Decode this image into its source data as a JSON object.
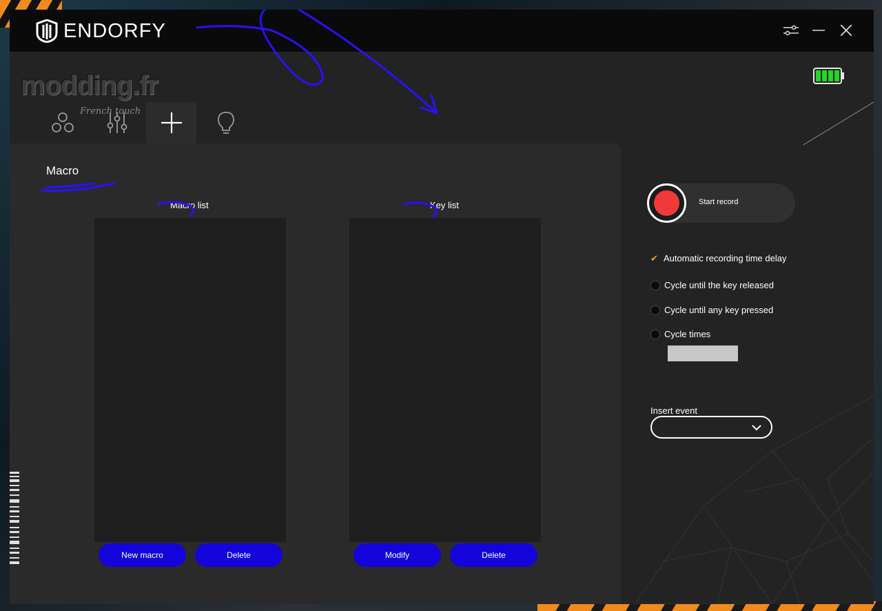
{
  "app": {
    "brand": "ENDORFY"
  },
  "watermark": {
    "main": "modding.fr",
    "sub": "French touch"
  },
  "titlebar": {
    "controls": [
      "settings-sliders-icon",
      "minimize-icon",
      "close-icon"
    ]
  },
  "battery": {
    "level": 1.0,
    "color": "#22d822"
  },
  "tabs": [
    {
      "icon": "circles-icon",
      "active": false
    },
    {
      "icon": "equalizer-icon",
      "active": false
    },
    {
      "icon": "plus-icon",
      "active": true
    },
    {
      "icon": "lightbulb-icon",
      "active": false
    }
  ],
  "panel": {
    "title": "Macro"
  },
  "macro_list": {
    "label": "Macro list",
    "items": [],
    "new_label": "New macro",
    "delete_label": "Delete"
  },
  "key_list": {
    "label": "Key list",
    "items": [],
    "modify_label": "Modify",
    "delete_label": "Delete"
  },
  "record": {
    "label": "Start record"
  },
  "options": {
    "auto_delay": {
      "label": "Automatic recording time delay",
      "checked": true
    },
    "cycle_release": {
      "label": "Cycle until the key released",
      "selected": false
    },
    "cycle_any": {
      "label": "Cycle until any key pressed",
      "selected": false
    },
    "cycle_times": {
      "label": "Cycle times",
      "selected": false,
      "value": ""
    }
  },
  "insert_event": {
    "label": "Insert event",
    "value": ""
  },
  "colors": {
    "accent": "#1404d9",
    "record": "#f03a3a",
    "check": "#f2a23a"
  }
}
